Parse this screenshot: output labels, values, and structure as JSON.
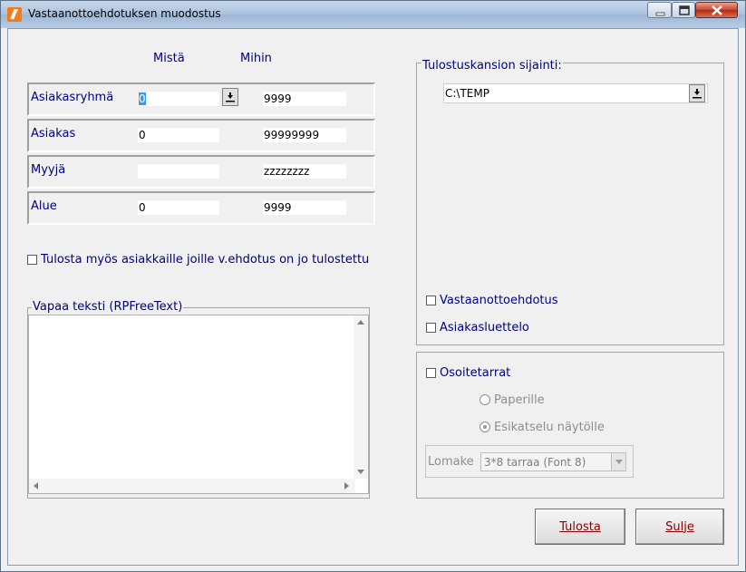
{
  "window": {
    "title": "Vastaanottoehdotuksen muodostus"
  },
  "columns": {
    "from": "Mistä",
    "to": "Mihin"
  },
  "rows": [
    {
      "label": "Asiakasryhmä",
      "from": "0",
      "to": "9999"
    },
    {
      "label": "Asiakas",
      "from": "0",
      "to": "99999999"
    },
    {
      "label": "Myyjä",
      "from": "",
      "to": "zzzzzzzz"
    },
    {
      "label": "Alue",
      "from": "0",
      "to": "9999"
    }
  ],
  "options": {
    "print_already_printed": "Tulosta myös asiakkaille joille v.ehdotus on jo tulostettu"
  },
  "free_text": {
    "legend": "Vapaa teksti (RPFreeText)",
    "value": ""
  },
  "output_folder": {
    "legend": "Tulostuskansion sijainti:",
    "value": "C:\\TEMP"
  },
  "reports": {
    "vastaanotto": "Vastaanottoehdotus",
    "asiakasluettelo": "Asiakasluettelo"
  },
  "labels_group": {
    "osoitetarrat": "Osoitetarrat",
    "paperille": "Paperille",
    "esikatselu": "Esikatselu näytölle",
    "lomake_label": "Lomake",
    "lomake_value": "3*8 tarraa (Font 8)"
  },
  "buttons": {
    "print": "Tulosta",
    "close": "Sulje"
  },
  "colors": {
    "label_text": "#000080",
    "button_text": "#8b0000",
    "title_gradient_top": "#c9d9ec"
  }
}
